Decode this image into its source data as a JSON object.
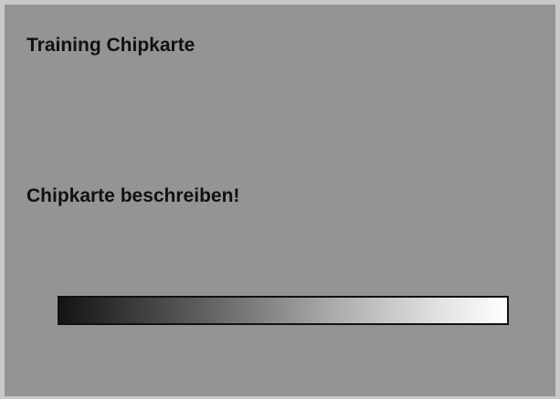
{
  "screen": {
    "title": "Training Chipkarte",
    "message": "Chipkarte beschreiben!",
    "progress": 1.0
  },
  "colors": {
    "background": "#939496",
    "frame": "#c8c9cb",
    "text": "#111111"
  }
}
